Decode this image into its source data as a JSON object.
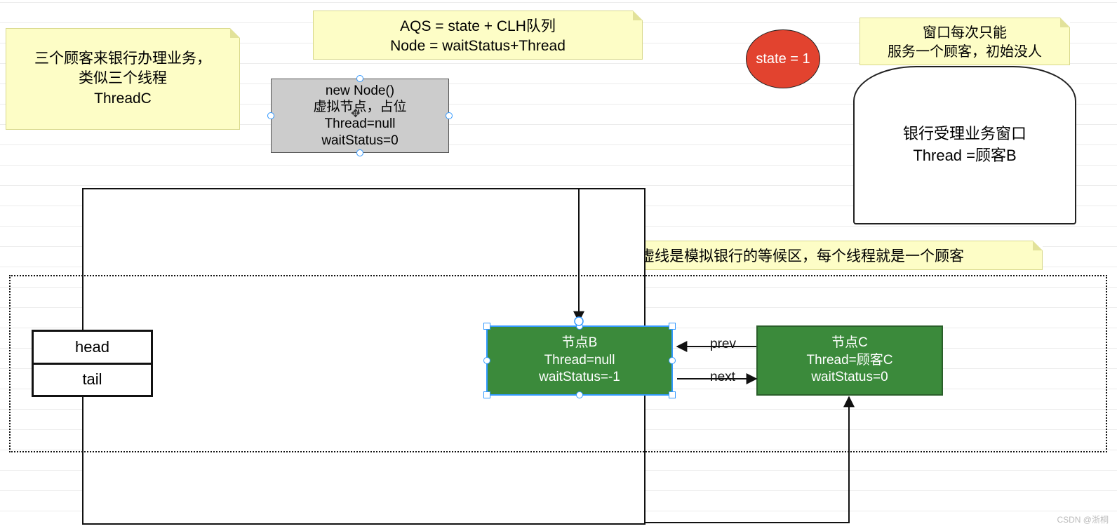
{
  "notes": {
    "customers": {
      "line1": "三个顾客来银行办理业务，",
      "line2": "类似三个线程",
      "line3": "ThreadC"
    },
    "aqs": {
      "line1": "AQS = state + CLH队列",
      "line2": "Node = waitStatus+Thread"
    },
    "window_above": {
      "line1": "窗口每次只能",
      "line2": "服务一个顾客，初始没人"
    },
    "waiting_area": "下面虚线是模拟银行的等候区，每个线程就是一个顾客"
  },
  "newnode": {
    "line1": "new Node()",
    "line2": "虚拟节点，占位",
    "line3": "Thread=null",
    "line4": "waitStatus=0"
  },
  "state_ellipse": "state = 1",
  "bank_window": {
    "line1": "银行受理业务窗口",
    "line2": "Thread =顾客B"
  },
  "headtail": {
    "head": "head",
    "tail": "tail"
  },
  "node_b": {
    "title": "节点B",
    "line2": "Thread=null",
    "line3": "waitStatus=-1"
  },
  "node_c": {
    "title": "节点C",
    "line2": "Thread=顾客C",
    "line3": "waitStatus=0"
  },
  "labels": {
    "prev": "prev",
    "next": "next"
  },
  "watermark": "CSDN @浙桐",
  "colors": {
    "note_bg": "#fdfdc6",
    "node_green": "#3b8a3b",
    "state_red": "#e2432f"
  }
}
